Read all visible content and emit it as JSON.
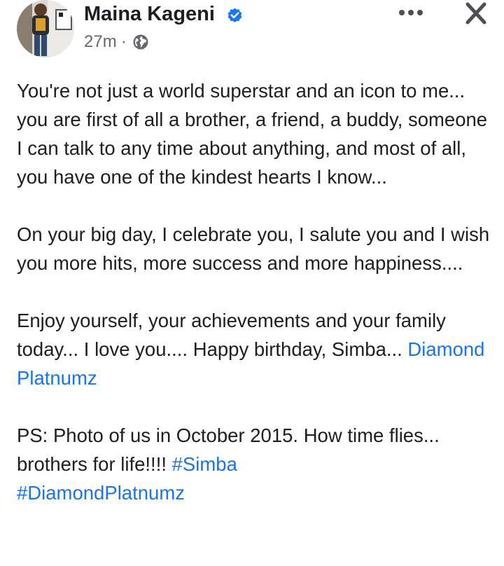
{
  "post": {
    "author": "Maina Kageni",
    "time": "27m",
    "separator": "·",
    "audience_icon": "globe-icon",
    "verified_icon": "verified-badge-icon",
    "more_icon": "more-options-icon",
    "close_icon": "close-icon",
    "paragraphs": [
      {
        "text": "You're not just a world superstar and an icon to me... you are first of all a brother, a friend, a buddy, someone I can talk to any time about anything, and most of all, you have one of the kindest hearts I know..."
      },
      {
        "text": "On your big day, I celebrate you, I salute you and I wish you more hits, more success and more happiness...."
      },
      {
        "text": "Enjoy yourself, your achievements and your family today... I love you.... Happy birthday, Simba... ",
        "link": "Diamond Platnumz"
      },
      {
        "text": "PS: Photo of us in October 2015. How time flies... brothers for life!!!! ",
        "hashtag1": "#Simba",
        "hashtag2": "#DiamondPlatnumz"
      }
    ]
  },
  "colors": {
    "link": "#1b74e4",
    "text": "#1c1e21",
    "meta": "#65676b",
    "verified": "#1877f2"
  }
}
